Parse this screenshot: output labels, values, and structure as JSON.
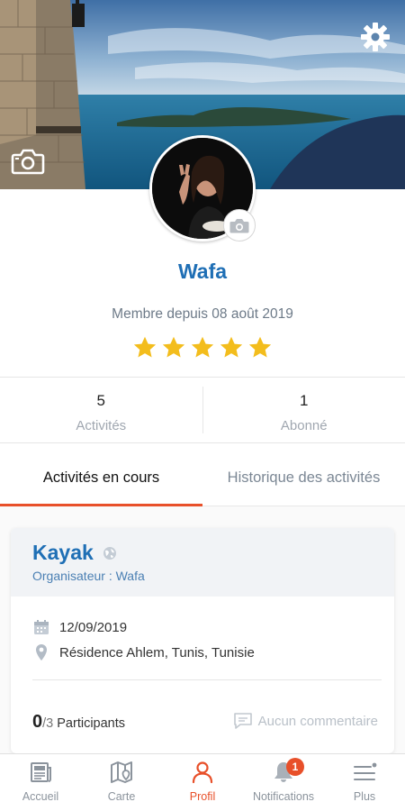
{
  "profile": {
    "name": "Wafa",
    "member_since": "Membre depuis 08 août 2019",
    "rating": 5
  },
  "stats": [
    {
      "value": "5",
      "label": "Activités"
    },
    {
      "value": "1",
      "label": "Abonné"
    }
  ],
  "tabs": [
    {
      "label": "Activités en cours",
      "active": true
    },
    {
      "label": "Historique des activités",
      "active": false
    }
  ],
  "activity": {
    "title": "Kayak",
    "organizer": "Organisateur : Wafa",
    "date": "12/09/2019",
    "location": "Résidence Ahlem, Tunis, Tunisie",
    "participants_current": "0",
    "participants_total": "/3",
    "participants_label": "Participants",
    "comments": "Aucun commentaire"
  },
  "bottom_nav": [
    {
      "label": "Accueil",
      "icon": "newspaper-icon"
    },
    {
      "label": "Carte",
      "icon": "map-icon"
    },
    {
      "label": "Profil",
      "icon": "user-icon",
      "active": true
    },
    {
      "label": "Notifications",
      "icon": "bell-icon",
      "badge": "1"
    },
    {
      "label": "Plus",
      "icon": "menu-icon"
    }
  ],
  "colors": {
    "accent": "#e8502a",
    "primary": "#1f6fb5",
    "star": "#f3bd1d"
  }
}
